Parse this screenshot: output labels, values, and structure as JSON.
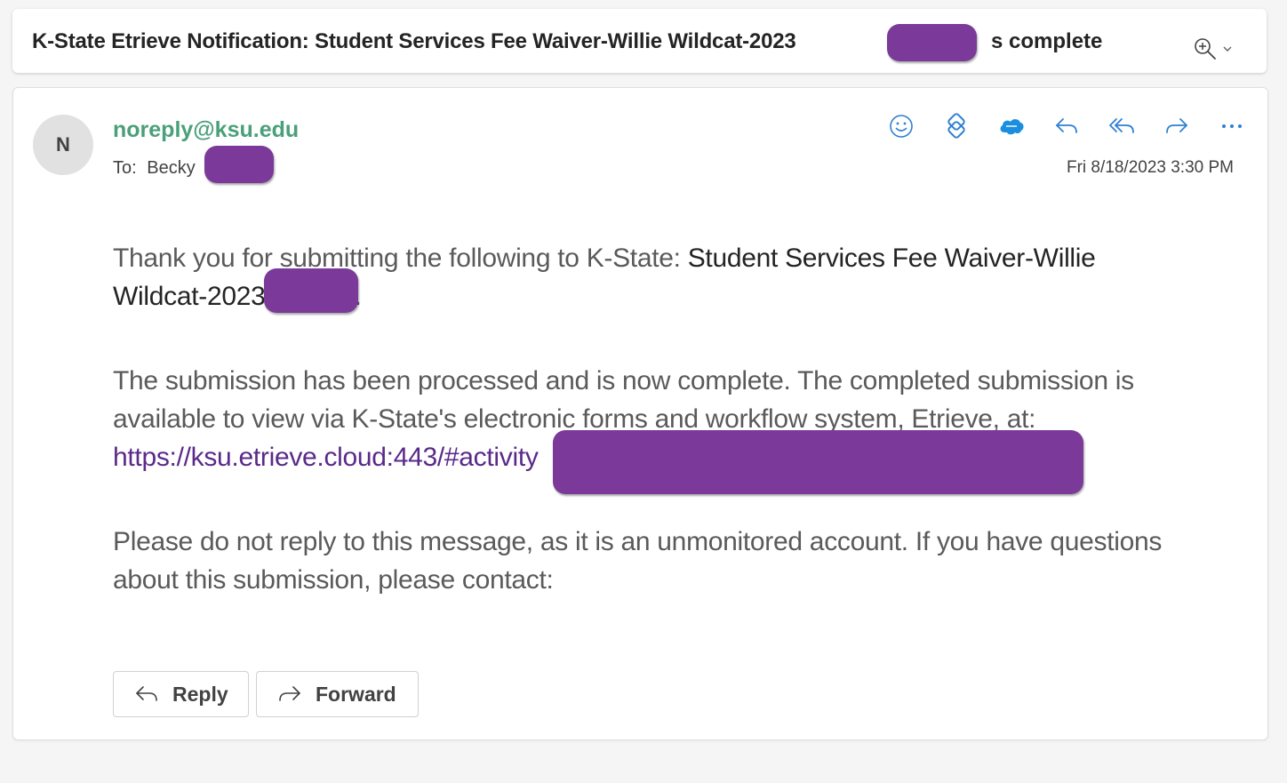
{
  "subject": {
    "title": "K-State Etrieve Notification: Student Services Fee Waiver-Willie Wildcat-2023",
    "suffix": "s complete"
  },
  "header": {
    "avatar_initial": "N",
    "sender": "noreply@ksu.edu",
    "to_label": "To:",
    "to_name": "Becky",
    "date": "Fri 8/18/2023 3:30 PM",
    "icons": [
      "emoji-icon",
      "loop-icon",
      "salesforce-icon",
      "reply-icon",
      "reply-all-icon",
      "forward-icon",
      "more-icon"
    ]
  },
  "body": {
    "p1_prefix": "Thank you for submitting the following to K-State: ",
    "p1_strong_a": "Student Services Fee Waiver-Willie",
    "p1_strong_b": "Wildcat-2023",
    "p1_end": ".",
    "p2_line1": "The submission has been processed and is now complete. The completed submission is",
    "p2_line2": "available to view via K-State's electronic forms and workflow system, Etrieve, at:",
    "p2_link": "https://ksu.etrieve.cloud:443/#activity",
    "p3_line1": "Please do not reply to this message, as it is an unmonitored account. If you have questions",
    "p3_line2": "about this submission, please contact:"
  },
  "actions": {
    "reply_label": "Reply",
    "forward_label": "Forward"
  },
  "colors": {
    "sender": "#4aa079",
    "accent_icons": "#2f7fd3",
    "redaction": "#7b3a9a",
    "link": "#5a2a8a"
  }
}
